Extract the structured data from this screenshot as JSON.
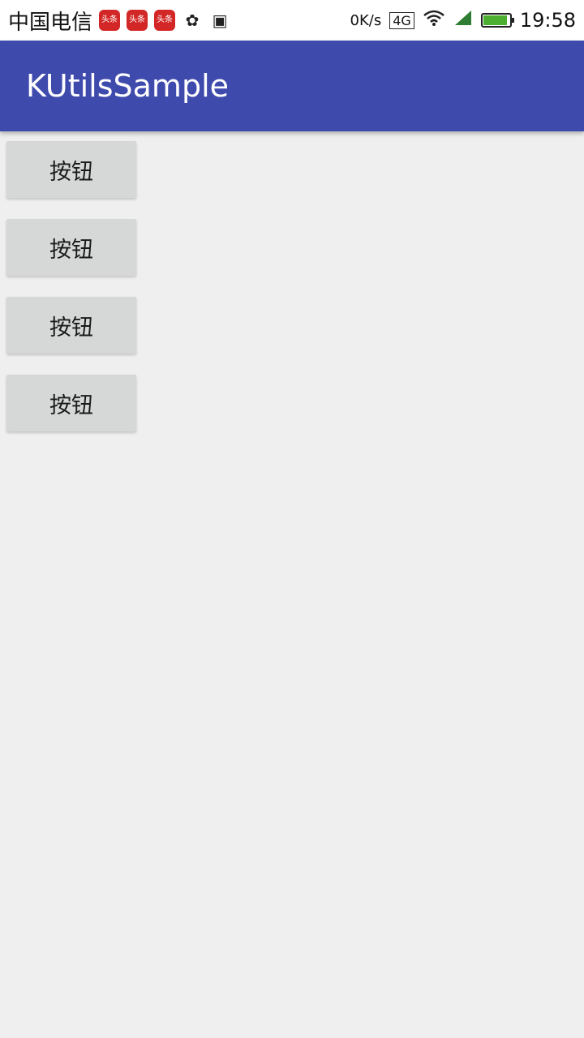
{
  "status_bar": {
    "carrier": "中国电信",
    "notification_badges": [
      "头条",
      "头条",
      "头条"
    ],
    "extra_icons": [
      "huawei-icon",
      "android-bag-icon"
    ],
    "network_speed": "0K/s",
    "network_type": "4G",
    "battery_level": 0.9,
    "clock": "19:58"
  },
  "app_bar": {
    "title": "KUtilsSample",
    "color": "#3f4aad"
  },
  "buttons": [
    {
      "label": "按钮"
    },
    {
      "label": "按钮"
    },
    {
      "label": "按钮"
    },
    {
      "label": "按钮"
    }
  ]
}
